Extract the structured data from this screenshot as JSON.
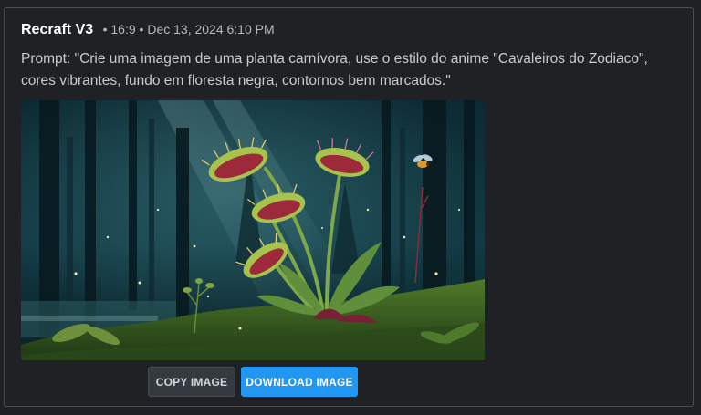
{
  "card": {
    "model": "Recraft V3",
    "meta": "• 16:9 • Dec 13, 2024 6:10 PM",
    "prompt": "Prompt: \"Crie uma imagem de uma planta carnívora, use o estilo do anime \"Cavaleiros do Zodiaco\", cores vibrantes, fundo em floresta negra, contornos bem marcados.\"",
    "image": {
      "alt": "Generated illustration of a Venus flytrap carnivorous plant with a fly, in a dark misty forest with glowing particles"
    },
    "buttons": {
      "copy": "COPY IMAGE",
      "download": "DOWNLOAD IMAGE"
    }
  },
  "colors": {
    "background": "#1f2124",
    "border": "#4a4d52",
    "accent": "#2196f3",
    "secondary_button": "#353a40"
  }
}
